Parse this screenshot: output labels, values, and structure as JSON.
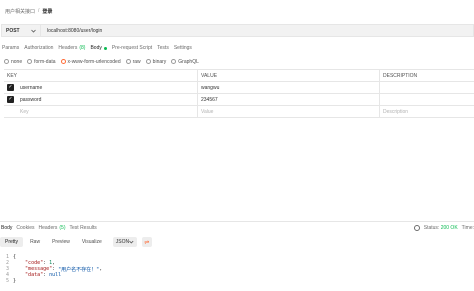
{
  "breadcrumb": {
    "parent": "用户相关接口",
    "separator": "/",
    "current": "登录"
  },
  "request": {
    "method": "POST",
    "url": "localhost:8080/user/login"
  },
  "request_tabs": [
    {
      "label": "Params"
    },
    {
      "label": "Authorization"
    },
    {
      "label": "Headers",
      "count": "(8)"
    },
    {
      "label": "Body"
    },
    {
      "label": "Pre-request Script"
    },
    {
      "label": "Tests"
    },
    {
      "label": "Settings"
    }
  ],
  "body_types": [
    {
      "label": "none"
    },
    {
      "label": "form-data"
    },
    {
      "label": "x-www-form-urlencoded"
    },
    {
      "label": "raw"
    },
    {
      "label": "binary"
    },
    {
      "label": "GraphQL"
    }
  ],
  "kv_table": {
    "headers": {
      "key": "KEY",
      "value": "VALUE",
      "description": "DESCRIPTION"
    },
    "rows": [
      {
        "key": "username",
        "value": "wangwu",
        "description": ""
      },
      {
        "key": "password",
        "value": "234567",
        "description": ""
      }
    ],
    "placeholder": {
      "key": "Key",
      "value": "Value",
      "description": "Description"
    }
  },
  "response_tabs": [
    {
      "label": "Body"
    },
    {
      "label": "Cookies"
    },
    {
      "label": "Headers",
      "count": "(5)"
    },
    {
      "label": "Test Results"
    }
  ],
  "response_status": {
    "status_label": "Status:",
    "status_value": "200 OK",
    "time_label": "Time:"
  },
  "view_tabs": [
    {
      "label": "Pretty"
    },
    {
      "label": "Raw"
    },
    {
      "label": "Preview"
    },
    {
      "label": "Visualize"
    }
  ],
  "format": {
    "selected": "JSON"
  },
  "response_body": {
    "line_numbers": [
      "1",
      "2",
      "3",
      "4",
      "5"
    ],
    "open_brace": "{",
    "code_key": "\"code\"",
    "code_value": "1",
    "message_key": "\"message\"",
    "message_value": "\"用户名不存在！\"",
    "data_key": "\"data\"",
    "data_value": "null",
    "close_brace": "}"
  },
  "colors": {
    "accent": "#ff6c37",
    "success": "#0cbb52"
  }
}
